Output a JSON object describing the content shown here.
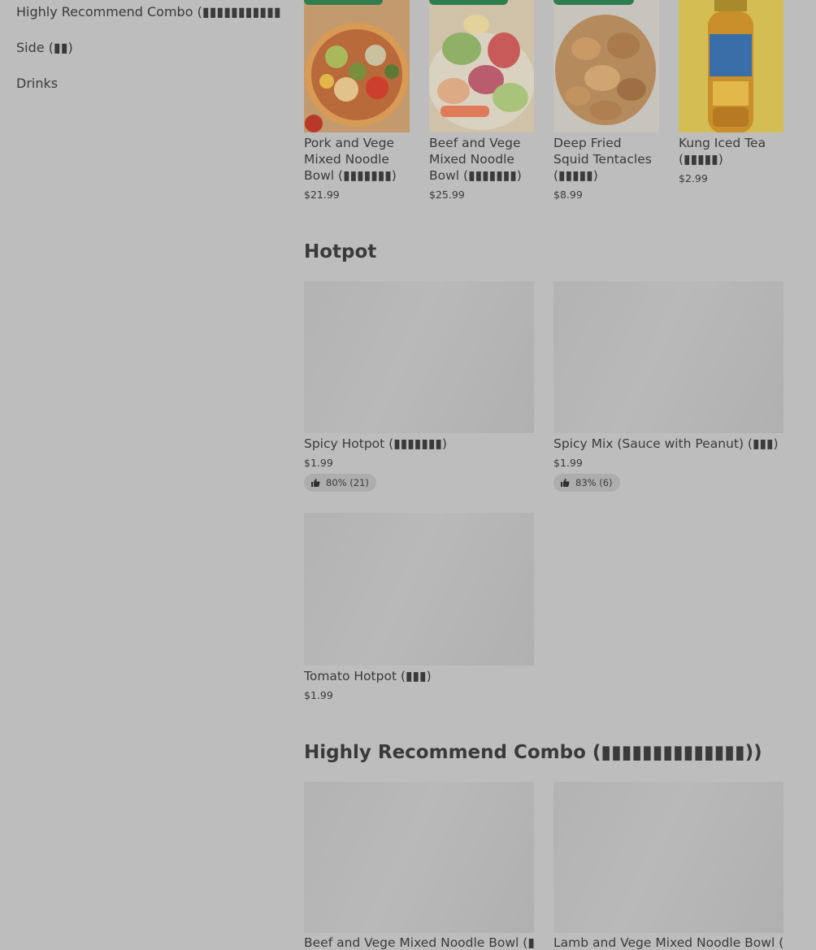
{
  "sidebar": {
    "items": [
      {
        "label": "Highly Recommend Combo (▮▮▮▮▮▮▮▮▮▮▮"
      },
      {
        "label": "Side (▮▮)"
      },
      {
        "label": "Drinks"
      }
    ]
  },
  "top_row": {
    "items": [
      {
        "name": "Pork and Vege Mixed Noodle Bowl (▮▮▮▮▮▮▮)",
        "price": "$21.99",
        "image": "noodle-bowl-photo"
      },
      {
        "name": "Beef and Vege Mixed Noodle Bowl (▮▮▮▮▮▮▮)",
        "price": "$25.99",
        "image": "beef-platter-photo"
      },
      {
        "name": "Deep Fried Squid Tentacles (▮▮▮▮▮)",
        "price": "$8.99",
        "image": "fried-squid-photo"
      },
      {
        "name": "Kung Iced Tea (▮▮▮▮▮)",
        "price": "$2.99",
        "image": "iced-tea-bottle-photo"
      }
    ]
  },
  "hotpot": {
    "title": "Hotpot",
    "items": [
      {
        "name": "Spicy Hotpot (▮▮▮▮▮▮▮)",
        "price": "$1.99",
        "rating": "80% (21)",
        "icon": "thumbs-up-icon"
      },
      {
        "name": "Spicy Mix (Sauce with Peanut) (▮▮▮)",
        "price": "$1.99",
        "rating": "83% (6)",
        "icon": "thumbs-up-icon"
      },
      {
        "name": "Tomato Hotpot (▮▮▮)",
        "price": "$1.99"
      }
    ]
  },
  "combo": {
    "title": "Highly Recommend Combo (▮▮▮▮▮▮▮▮▮▮▮▮▮▮))",
    "items": [
      {
        "name": "Beef and Vege Mixed Noodle Bowl (▮▮"
      },
      {
        "name": "Lamb and Vege Mixed Noodle Bowl (▮"
      }
    ]
  },
  "colors": {
    "overlay_bg": "#bdbdbd",
    "text": "#3a3a3a",
    "badge_green": "#2e7d4c",
    "placeholder": "#b3b3b3"
  }
}
